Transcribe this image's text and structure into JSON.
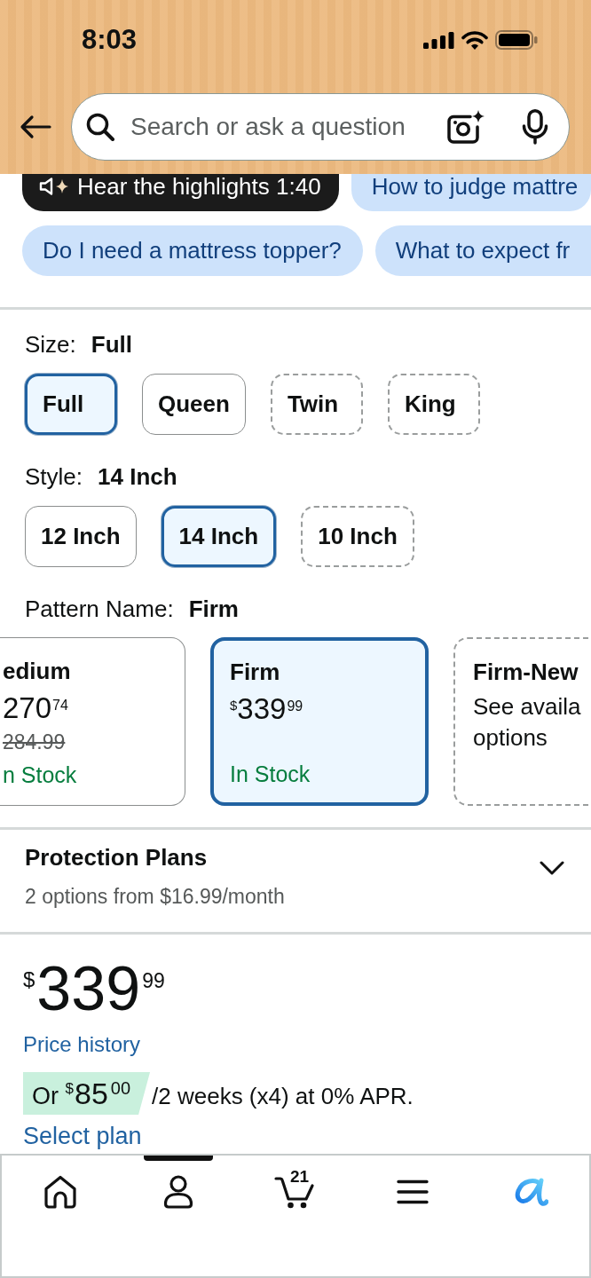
{
  "status_bar": {
    "time": "8:03"
  },
  "search": {
    "placeholder": "Search or ask a question"
  },
  "chip_rows": [
    {
      "chips": [
        {
          "kind": "audio",
          "label": "Hear the highlights 1:40"
        },
        {
          "kind": "question",
          "label": "How to judge mattre"
        }
      ]
    },
    {
      "chips": [
        {
          "kind": "question",
          "label": "Do I need a mattress topper?"
        },
        {
          "kind": "question",
          "label": "What to expect fr"
        }
      ]
    }
  ],
  "variations": [
    {
      "label": "Size:",
      "value": "Full",
      "options": [
        {
          "label": "Full",
          "selected": true,
          "available": true
        },
        {
          "label": "Queen",
          "selected": false,
          "available": true
        },
        {
          "label": "Twin",
          "selected": false,
          "available": false
        },
        {
          "label": "King",
          "selected": false,
          "available": false
        }
      ]
    },
    {
      "label": "Style:",
      "value": "14 Inch",
      "options": [
        {
          "label": "12 Inch",
          "selected": false,
          "available": true
        },
        {
          "label": "14 Inch",
          "selected": true,
          "available": true
        },
        {
          "label": "10 Inch",
          "selected": false,
          "available": false
        }
      ]
    }
  ],
  "pattern": {
    "label": "Pattern Name:",
    "value": "Firm",
    "cards": [
      {
        "title": "edium",
        "price": {
          "whole": "270",
          "fraction": "74"
        },
        "list_price": "284.99",
        "stock": "n Stock",
        "selected": false,
        "available": true
      },
      {
        "title": "Firm",
        "price": {
          "symbol": "$",
          "whole": "339",
          "fraction": "99"
        },
        "stock": "In Stock",
        "selected": true,
        "available": true
      },
      {
        "title": "Firm-New",
        "note_lines": [
          "See availa",
          "options"
        ],
        "selected": false,
        "available": false
      }
    ]
  },
  "protection": {
    "title": "Protection Plans",
    "subtitle": "2 options from $16.99/month",
    "expanded": false
  },
  "price": {
    "symbol": "$",
    "whole": "339",
    "fraction": "99"
  },
  "price_history_link": "Price history",
  "installment": {
    "prefix": "Or",
    "symbol": "$",
    "whole": "85",
    "fraction": "00",
    "terms": "/2 weeks (x4) at 0% APR."
  },
  "select_plan_link": "Select plan",
  "tab_bar": {
    "tabs": [
      {
        "kind": "home",
        "selected": false
      },
      {
        "kind": "profile",
        "selected": true
      },
      {
        "kind": "cart",
        "selected": false,
        "badge": "21"
      },
      {
        "kind": "menu",
        "selected": false
      },
      {
        "kind": "assistant",
        "selected": false
      }
    ]
  }
}
